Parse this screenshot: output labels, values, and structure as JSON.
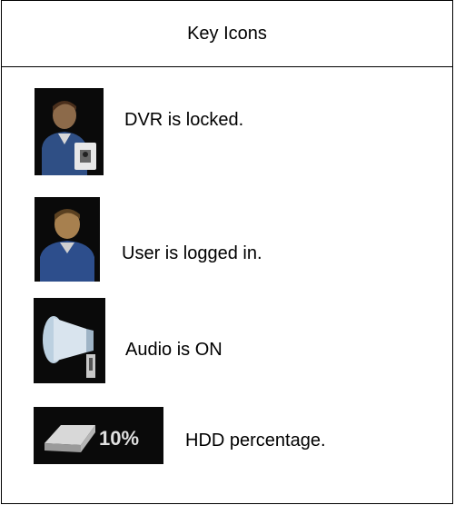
{
  "header": {
    "title": "Key Icons"
  },
  "rows": [
    {
      "icon": "user-lock-icon",
      "label": "DVR is locked."
    },
    {
      "icon": "user-icon",
      "label": "User is logged in."
    },
    {
      "icon": "speaker-icon",
      "label": "Audio is ON"
    },
    {
      "icon": "hdd-icon",
      "badge": "10%",
      "label": "HDD percentage."
    }
  ]
}
